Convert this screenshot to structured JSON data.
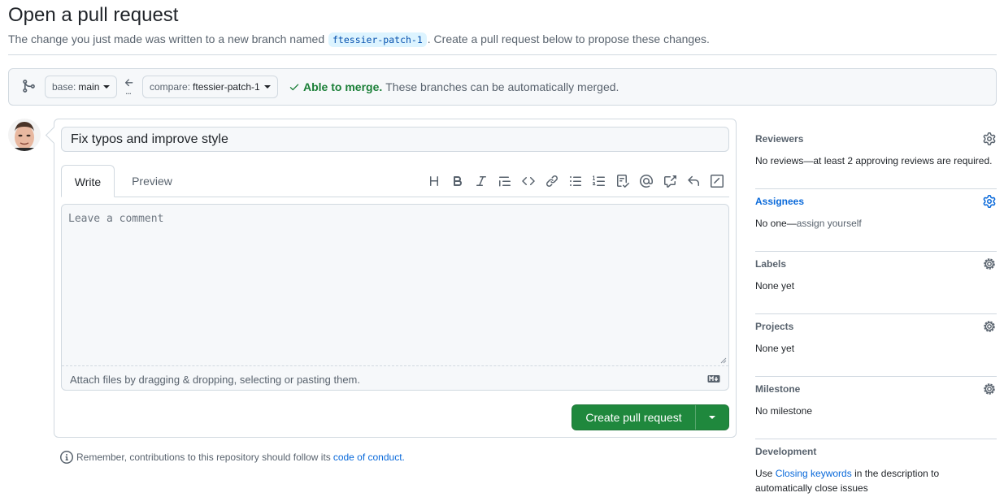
{
  "page": {
    "title": "Open a pull request",
    "subtitle_before": "The change you just made was written to a new branch named",
    "branch_name": "ftessier-patch-1",
    "subtitle_after": ". Create a pull request below to propose these changes."
  },
  "range": {
    "base_label": "base:",
    "base_value": "main",
    "compare_label": "compare:",
    "compare_value": "ftessier-patch-1",
    "dots": "...",
    "merge_ok": "Able to merge.",
    "merge_detail": "These branches can be automatically merged."
  },
  "form": {
    "title_value": "Fix typos and improve style",
    "tab_write": "Write",
    "tab_preview": "Preview",
    "comment_placeholder": "Leave a comment",
    "attach_text": "Attach files by dragging & dropping, selecting or pasting them.",
    "create_button": "Create pull request",
    "toolbar_icons": [
      "heading-icon",
      "bold-icon",
      "italic-icon",
      "quote-icon",
      "code-icon",
      "link-icon",
      "unordered-list-icon",
      "ordered-list-icon",
      "task-list-icon",
      "mention-icon",
      "cross-reference-icon",
      "reply-icon",
      "slash-commands-icon"
    ]
  },
  "footer": {
    "remember_text": "Remember, contributions to this repository should follow its",
    "remember_link": "code of conduct."
  },
  "sidebar": {
    "reviewers": {
      "title": "Reviewers",
      "text": "No reviews—at least 2 approving reviews are required."
    },
    "assignees": {
      "title": "Assignees",
      "text_a": "No one—",
      "text_b": "assign yourself"
    },
    "labels": {
      "title": "Labels",
      "text": "None yet"
    },
    "projects": {
      "title": "Projects",
      "text": "None yet"
    },
    "milestone": {
      "title": "Milestone",
      "text": "No milestone"
    },
    "development": {
      "title": "Development",
      "text_a": "Use",
      "link": "Closing keywords",
      "text_b": "in the description to",
      "text_c": "automatically close issues"
    }
  },
  "colors": {
    "accent": "#0969da",
    "success": "#1a7f37",
    "button_green": "#1f883d",
    "border": "#d1d9e0"
  }
}
